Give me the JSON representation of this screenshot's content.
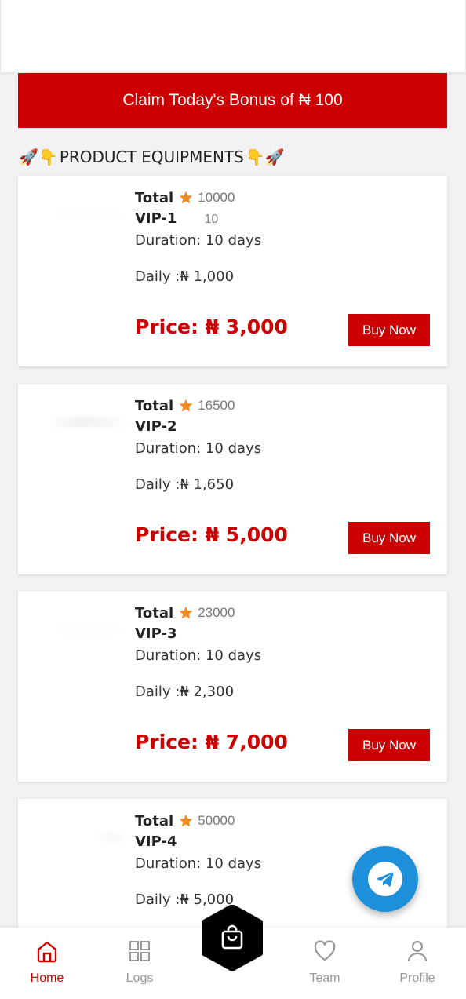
{
  "bonus": {
    "label": "Claim Today's Bonus of ₦ 100"
  },
  "section": {
    "title": "PRODUCT EQUIPMENTS",
    "emoji_left": "🚀👇",
    "emoji_right": "👇🚀"
  },
  "products": [
    {
      "total_label": "Total",
      "total_value": "10000",
      "level": "VIP-1",
      "level_extra": "10",
      "duration": "Duration: 10 days",
      "daily": "Daily :₦ 1,000",
      "price": "Price: ₦ 3,000",
      "buy_label": "Buy Now"
    },
    {
      "total_label": "Total",
      "total_value": "16500",
      "level": "VIP-2",
      "level_extra": "",
      "duration": "Duration: 10 days",
      "daily": "Daily :₦ 1,650",
      "price": "Price: ₦ 5,000",
      "buy_label": "Buy Now"
    },
    {
      "total_label": "Total",
      "total_value": "23000",
      "level": "VIP-3",
      "level_extra": "",
      "duration": "Duration: 10 days",
      "daily": "Daily :₦ 2,300",
      "price": "Price: ₦ 7,000",
      "buy_label": "Buy Now"
    },
    {
      "total_label": "Total",
      "total_value": "50000",
      "level": "VIP-4",
      "level_extra": "",
      "duration": "Duration: 10 days",
      "daily": "Daily :₦ 5,000",
      "price": "",
      "buy_label": ""
    }
  ],
  "nav": {
    "home": "Home",
    "logs": "Logs",
    "team": "Team",
    "profile": "Profile"
  },
  "icons": {
    "star": "star-icon",
    "telegram": "telegram-icon",
    "home": "home-icon",
    "logs": "grid-icon",
    "center": "shopping-bag-icon",
    "team": "heart-icon",
    "profile": "user-icon"
  },
  "colors": {
    "accent": "#cc0000",
    "star": "#f08a24",
    "telegram": "#1e8fd9",
    "nav_inactive": "#999999"
  }
}
